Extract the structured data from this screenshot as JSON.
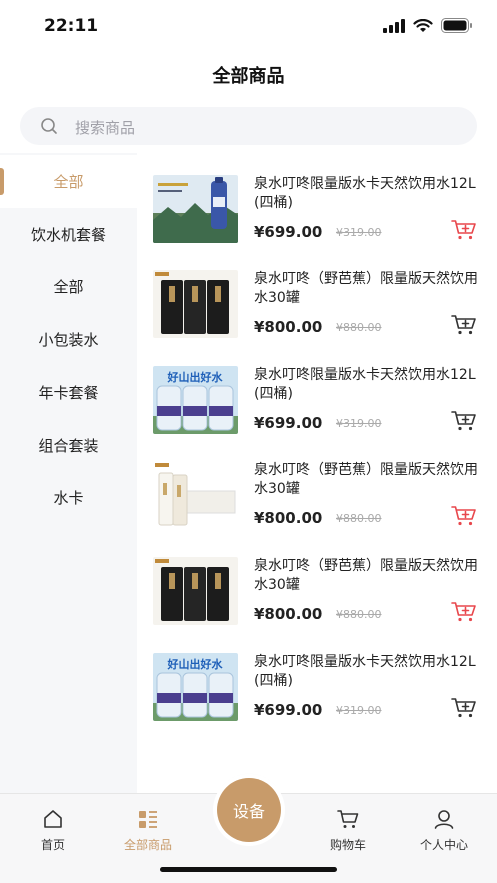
{
  "status_bar": {
    "time": "22:11"
  },
  "header": {
    "title": "全部商品"
  },
  "search": {
    "placeholder": "搜索商品"
  },
  "sidebar": {
    "items": [
      {
        "label": "全部",
        "active": true
      },
      {
        "label": "饮水机套餐"
      },
      {
        "label": "全部"
      },
      {
        "label": "小包装水"
      },
      {
        "label": "年卡套餐"
      },
      {
        "label": "组合套装"
      },
      {
        "label": "水卡"
      }
    ]
  },
  "products": [
    {
      "name": "泉水叮咚限量版水卡天然饮用水12L (四桶)",
      "price": "¥699.00",
      "original_price": "¥319.00",
      "cart_color": "#e8474c",
      "thumb": "bottle"
    },
    {
      "name": "泉水叮咚（野芭蕉）限量版天然饮用水30罐",
      "price": "¥800.00",
      "original_price": "¥880.00",
      "cart_color": "#333333",
      "thumb": "cans-black"
    },
    {
      "name": "泉水叮咚限量版水卡天然饮用水12L (四桶)",
      "price": "¥699.00",
      "original_price": "¥319.00",
      "cart_color": "#333333",
      "thumb": "jugs",
      "thumb_text": "好山出好水"
    },
    {
      "name": "泉水叮咚（野芭蕉）限量版天然饮用水30罐",
      "price": "¥800.00",
      "original_price": "¥880.00",
      "cart_color": "#e8474c",
      "thumb": "cans-white"
    },
    {
      "name": "泉水叮咚（野芭蕉）限量版天然饮用水30罐",
      "price": "¥800.00",
      "original_price": "¥880.00",
      "cart_color": "#e8474c",
      "thumb": "cans-black"
    },
    {
      "name": "泉水叮咚限量版水卡天然饮用水12L (四桶)",
      "price": "¥699.00",
      "original_price": "¥319.00",
      "cart_color": "#333333",
      "thumb": "jugs",
      "thumb_text": "好山出好水"
    }
  ],
  "tabbar": {
    "home": "首页",
    "all_products": "全部商品",
    "center": "设备",
    "cart": "购物车",
    "profile": "个人中心"
  },
  "colors": {
    "accent": "#c89b6a",
    "cart_red": "#e8474c"
  }
}
